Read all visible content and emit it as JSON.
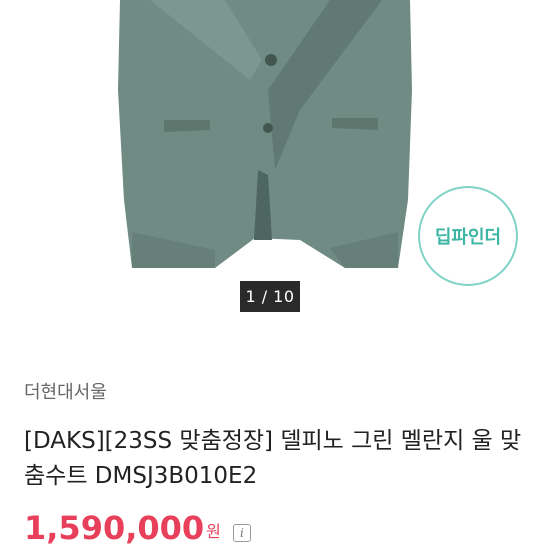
{
  "gallery": {
    "pager_text": "1 / 10",
    "badge_text": "딥파인더"
  },
  "product": {
    "store_name": "더현대서울",
    "title": "[DAKS][23SS 맞춤정장] 델피노 그린 멜란지 울 맞춤수트 DMSJ3B010E2",
    "price": "1,590,000",
    "price_unit": "원"
  },
  "icons": {
    "info": "info-icon"
  },
  "colors": {
    "price": "#e8405a",
    "badge": "#7fd3c6",
    "jacket": "#6e8a82"
  }
}
